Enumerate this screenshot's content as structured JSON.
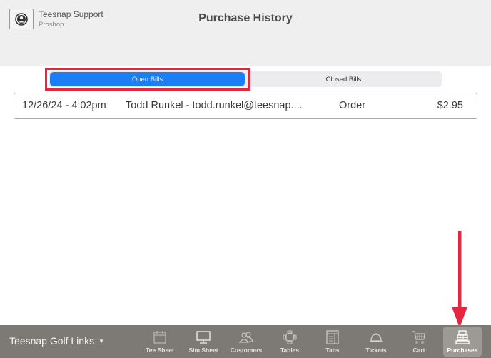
{
  "header": {
    "user_name": "Teesnap Support",
    "user_role": "Proshop",
    "title": "Purchase History"
  },
  "segments": {
    "open_label": "Open Bills",
    "closed_label": "Closed Bills",
    "selected": "Open Bills"
  },
  "bills": [
    {
      "date": "12/26/24 - 4:02pm",
      "customer": "Todd Runkel - todd.runkel@teesnap....",
      "type": "Order",
      "amount": "$2.95"
    }
  ],
  "tabbar": {
    "location": "Teesnap Golf Links",
    "tabs": [
      {
        "label": "Tee Sheet",
        "icon": "calendar-icon"
      },
      {
        "label": "Sim Sheet",
        "icon": "monitor-icon"
      },
      {
        "label": "Customers",
        "icon": "users-icon"
      },
      {
        "label": "Tables",
        "icon": "table-icon"
      },
      {
        "label": "Tabs",
        "icon": "receipt-icon"
      },
      {
        "label": "Tickets",
        "icon": "cloche-icon"
      },
      {
        "label": "Cart",
        "icon": "cart-icon"
      },
      {
        "label": "Purchases",
        "icon": "cash-register-icon",
        "active": true
      }
    ]
  },
  "colors": {
    "accent": "#1a7ef5",
    "annotation": "#e8253f",
    "tabbar": "#7d7a75"
  }
}
